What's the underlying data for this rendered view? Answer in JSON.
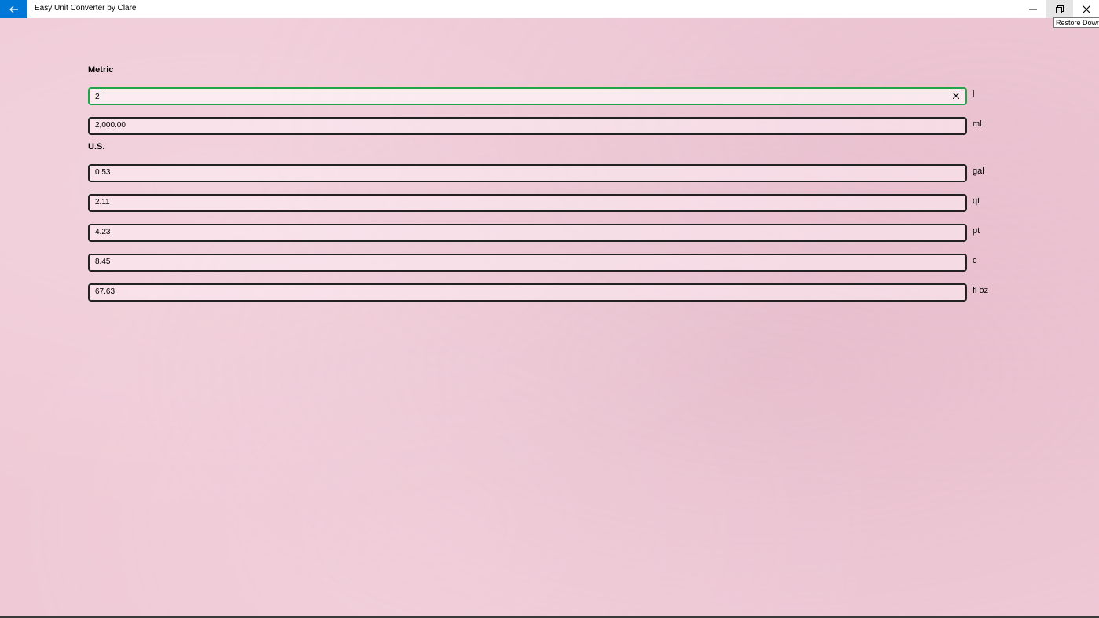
{
  "window": {
    "title": "Easy Unit Converter by Clare",
    "tooltip": "Restore Down"
  },
  "metric": {
    "label": "Metric",
    "fields": [
      {
        "value": "2",
        "unit": "l"
      },
      {
        "value": "2,000.00",
        "unit": "ml"
      }
    ]
  },
  "us": {
    "label": "U.S.",
    "fields": [
      {
        "value": "0.53",
        "unit": "gal"
      },
      {
        "value": "2.11",
        "unit": "qt"
      },
      {
        "value": "4.23",
        "unit": "pt"
      },
      {
        "value": "8.45",
        "unit": "c"
      },
      {
        "value": "67.63",
        "unit": "fl oz"
      }
    ]
  },
  "colors": {
    "accent": "#0078d7",
    "focus_border": "#22a54a",
    "background": "#efc9d6"
  }
}
